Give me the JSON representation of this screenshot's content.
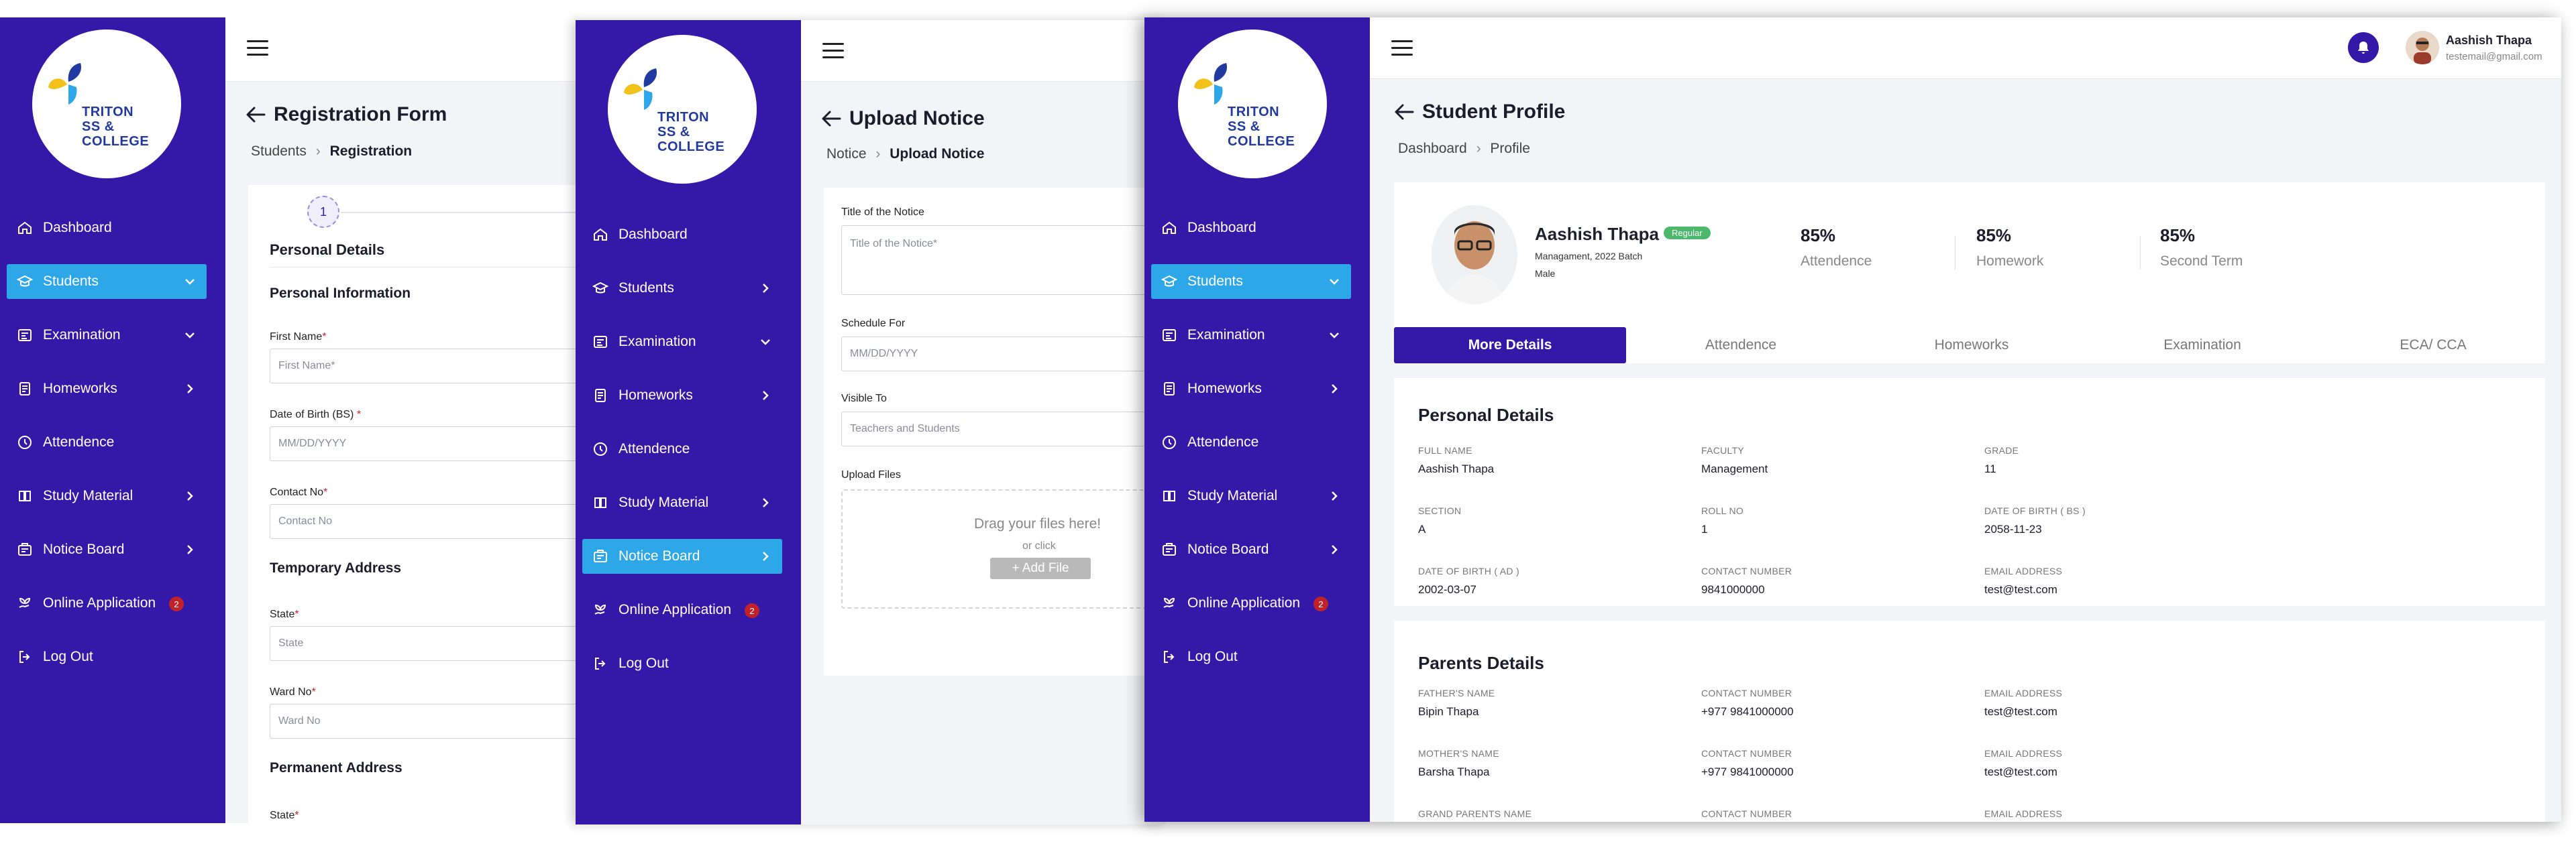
{
  "school": {
    "name_line1": "TRITON",
    "name_line2": "SS & COLLEGE"
  },
  "colors": {
    "sidebar": "#3418a8",
    "active_nav": "#2ea7e8",
    "primary": "#3418a8",
    "badge": "#c0222b",
    "regular_badge": "#4cb86b"
  },
  "panel1": {
    "nav": [
      {
        "label": "Dashboard",
        "icon": "home-icon",
        "chevron": "",
        "badge": ""
      },
      {
        "label": "Students",
        "icon": "graduation-cap-icon",
        "chevron": "down",
        "badge": ""
      },
      {
        "label": "Examination",
        "icon": "exam-icon",
        "chevron": "down",
        "badge": ""
      },
      {
        "label": "Homeworks",
        "icon": "homework-icon",
        "chevron": "right",
        "badge": ""
      },
      {
        "label": "Attendence",
        "icon": "clock-icon",
        "chevron": "",
        "badge": ""
      },
      {
        "label": "Study Material",
        "icon": "book-icon",
        "chevron": "right",
        "badge": ""
      },
      {
        "label": "Notice Board",
        "icon": "notice-icon",
        "chevron": "right",
        "badge": ""
      },
      {
        "label": "Online Application",
        "icon": "hand-plant-icon",
        "chevron": "",
        "badge": "2"
      },
      {
        "label": "Log Out",
        "icon": "logout-icon",
        "chevron": "",
        "badge": ""
      }
    ],
    "title": "Registration Form",
    "breadcrumb": {
      "parent": "Students",
      "current": "Registration"
    },
    "step_number": "1",
    "step_title": "Personal Details",
    "section_personal": "Personal Information",
    "first_name_label": "First Name",
    "first_name_placeholder": "First Name*",
    "dob_label": "Date of Birth (BS)",
    "dob_placeholder": "MM/DD/YYYY",
    "contact_label": "Contact No",
    "contact_placeholder": "Contact No",
    "section_temporary": "Temporary Address",
    "state_label": "State",
    "state_placeholder": "State",
    "ward_label": "Ward No",
    "ward_placeholder": "Ward No",
    "section_permanent": "Permanent Address",
    "state2_label": "State"
  },
  "panel2": {
    "nav": [
      {
        "label": "Dashboard",
        "icon": "home-icon",
        "chevron": "",
        "badge": ""
      },
      {
        "label": "Students",
        "icon": "graduation-cap-icon",
        "chevron": "right",
        "badge": ""
      },
      {
        "label": "Examination",
        "icon": "exam-icon",
        "chevron": "down",
        "badge": ""
      },
      {
        "label": "Homeworks",
        "icon": "homework-icon",
        "chevron": "right",
        "badge": ""
      },
      {
        "label": "Attendence",
        "icon": "clock-icon",
        "chevron": "",
        "badge": ""
      },
      {
        "label": "Study Material",
        "icon": "book-icon",
        "chevron": "right",
        "badge": ""
      },
      {
        "label": "Notice Board",
        "icon": "notice-icon",
        "chevron": "right",
        "badge": ""
      },
      {
        "label": "Online Application",
        "icon": "hand-plant-icon",
        "chevron": "",
        "badge": "2"
      },
      {
        "label": "Log Out",
        "icon": "logout-icon",
        "chevron": "",
        "badge": ""
      }
    ],
    "title": "Upload Notice",
    "breadcrumb": {
      "parent": "Notice",
      "current": "Upload Notice"
    },
    "title_label": "Title of the Notice",
    "title_placeholder": "Title of the Notice*",
    "schedule_label": "Schedule For",
    "schedule_placeholder": "MM/DD/YYYY",
    "visible_label": "Visible To",
    "visible_value": "Teachers and Students",
    "upload_label": "Upload Files",
    "drop_text": "Drag your files here!",
    "or_text": "or click",
    "add_file": "+ Add File"
  },
  "panel3": {
    "nav": [
      {
        "label": "Dashboard",
        "icon": "home-icon",
        "chevron": "",
        "badge": ""
      },
      {
        "label": "Students",
        "icon": "graduation-cap-icon",
        "chevron": "down",
        "badge": ""
      },
      {
        "label": "Examination",
        "icon": "exam-icon",
        "chevron": "down",
        "badge": ""
      },
      {
        "label": "Homeworks",
        "icon": "homework-icon",
        "chevron": "right",
        "badge": ""
      },
      {
        "label": "Attendence",
        "icon": "clock-icon",
        "chevron": "",
        "badge": ""
      },
      {
        "label": "Study Material",
        "icon": "book-icon",
        "chevron": "right",
        "badge": ""
      },
      {
        "label": "Notice Board",
        "icon": "notice-icon",
        "chevron": "right",
        "badge": ""
      },
      {
        "label": "Online Application",
        "icon": "hand-plant-icon",
        "chevron": "",
        "badge": "2"
      },
      {
        "label": "Log Out",
        "icon": "logout-icon",
        "chevron": "",
        "badge": ""
      }
    ],
    "user": {
      "name": "Aashish Thapa",
      "email": "testemail@gmail.com"
    },
    "title": "Student Profile",
    "breadcrumb": {
      "parent": "Dashboard",
      "current": "Profile"
    },
    "student": {
      "name": "Aashish Thapa",
      "status": "Regular",
      "batch": "Managament, 2022 Batch",
      "gender": "Male"
    },
    "stats": [
      {
        "value": "85%",
        "label": "Attendence"
      },
      {
        "value": "85%",
        "label": "Homework"
      },
      {
        "value": "85%",
        "label": "Second Term"
      }
    ],
    "tabs": [
      "More Details",
      "Attendence",
      "Homeworks",
      "Examination",
      "ECA/ CCA"
    ],
    "personal_title": "Personal Details",
    "personal": [
      {
        "label": "FULL NAME",
        "value": "Aashish Thapa"
      },
      {
        "label": "FACULTY",
        "value": "Management"
      },
      {
        "label": "GRADE",
        "value": "11"
      },
      {
        "label": "SECTION",
        "value": "A"
      },
      {
        "label": "ROLL NO",
        "value": "1"
      },
      {
        "label": "DATE OF BIRTH ( BS )",
        "value": "2058-11-23"
      },
      {
        "label": "DATE OF BIRTH ( AD )",
        "value": "2002-03-07"
      },
      {
        "label": "CONTACT NUMBER",
        "value": "9841000000"
      },
      {
        "label": "EMAIL ADDRESS",
        "value": "test@test.com"
      }
    ],
    "parents_title": "Parents Details",
    "parents": [
      {
        "label": "FATHER'S NAME",
        "value": "Bipin Thapa"
      },
      {
        "label": "CONTACT NUMBER",
        "value": "+977 9841000000"
      },
      {
        "label": "EMAIL ADDRESS",
        "value": "test@test.com"
      },
      {
        "label": "MOTHER'S NAME",
        "value": "Barsha Thapa"
      },
      {
        "label": "CONTACT NUMBER",
        "value": "+977 9841000000"
      },
      {
        "label": "EMAIL ADDRESS",
        "value": "test@test.com"
      },
      {
        "label": "GRAND PARENTS NAME",
        "value": ""
      },
      {
        "label": "CONTACT NUMBER",
        "value": ""
      },
      {
        "label": "EMAIL ADDRESS",
        "value": ""
      }
    ]
  }
}
